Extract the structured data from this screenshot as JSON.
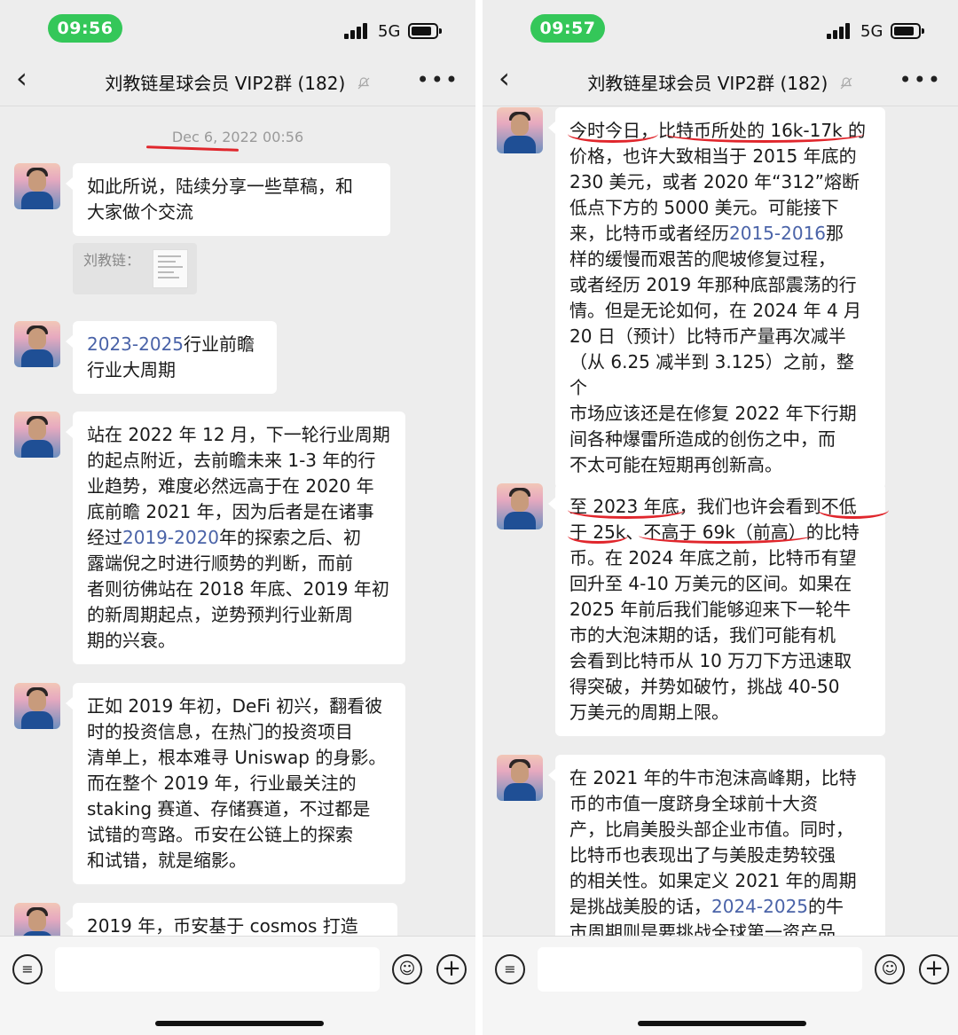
{
  "left": {
    "status": {
      "time": "09:56",
      "network": "5G"
    },
    "nav": {
      "title": "刘教链星球会员 VIP2群 (182)"
    },
    "timestamp": "Dec 6, 2022 00:56",
    "messages": [
      {
        "lines": [
          "如此所说，陆续分享一些草稿，和",
          "大家做个交流"
        ]
      },
      {
        "quote_label": "刘教链："
      },
      {
        "link": "2023-2025",
        "text1": "行业前瞻",
        "text2": "行业大周期"
      },
      {
        "lines_a": [
          "站在 2022 年 12 月，下一轮行业周期",
          "的起点附近，去前瞻未来 1-3 年的行",
          "业趋势，难度必然远高于在 2020 年",
          "底前瞻 2021 年，因为后者是在诸事"
        ],
        "line_link_pre": "经过",
        "line_link": "2019-2020",
        "line_link_post": "年的探索之后、初",
        "lines_b": [
          "露端倪之时进行顺势的判断，而前",
          "者则彷佛站在 2018 年底、2019 年初",
          "的新周期起点，逆势预判行业新周",
          "期的兴衰。"
        ]
      },
      {
        "lines": [
          "正如 2019 年初，DeFi 初兴，翻看彼",
          "时的投资信息，在热门的投资项目",
          "清单上，根本难寻 Uniswap 的身影。",
          "而在整个 2019 年，行业最关注的",
          "staking 赛道、存储赛道，不过都是",
          "试错的弯路。币安在公链上的探索",
          "和试错，就是缩影。"
        ]
      },
      {
        "lines": [
          "2019 年，币安基于 cosmos 打造"
        ]
      }
    ]
  },
  "right": {
    "status": {
      "time": "09:57",
      "network": "5G"
    },
    "nav": {
      "title": "刘教链星球会员 VIP2群 (182)"
    },
    "messages": [
      {
        "l1": "今时今日，比特币所处的 16k-17k 的",
        "l2": "价格，也许大致相当于 2015 年底的",
        "l3": "230 美元，或者 2020 年“312”熔断",
        "l4": "低点下方的 5000 美元。可能接下",
        "l5_pre": "来，比特币或者经历",
        "l5_link": "2015-2016",
        "l5_post": "那",
        "l6": "样的缓慢而艰苦的爬坡修复过程，",
        "l7": "或者经历 2019 年那种底部震荡的行",
        "l8": "情。但是无论如何，在 2024 年 4 月",
        "l9": "20 日（预计）比特币产量再次减半",
        "l10": "（从 6.25 减半到 3.125）之前，整个",
        "l11": "市场应该还是在修复 2022 年下行期",
        "l12": "间各种爆雷所造成的创伤之中，而",
        "l13": "不太可能在短期再创新高。"
      },
      {
        "lines": [
          "至 2023 年底，我们也许会看到不低",
          "于 25k、不高于 69k（前高）的比特",
          "币。在 2024 年底之前，比特币有望",
          "回升至 4-10 万美元的区间。如果在",
          "2025 年前后我们能够迎来下一轮牛",
          "市的大泡沫期的话，我们可能有机",
          "会看到比特币从 10 万刀下方迅速取",
          "得突破，并势如破竹，挑战 40-50",
          "万美元的周期上限。"
        ]
      },
      {
        "l1": "在 2021 年的牛市泡沫高峰期，比特",
        "l2": "币的市值一度跻身全球前十大资",
        "l3": "产，比肩美股头部企业市值。同时，",
        "l4": "比特币也表现出了与美股走势较强",
        "l5": "的相关性。如果定义 2021 年的周期",
        "l6_pre": "是挑战美股的话，",
        "l6_link": "2024-2025",
        "l6_post": "的牛",
        "l7": "市周期则是要挑战全球第一资产品"
      }
    ]
  }
}
